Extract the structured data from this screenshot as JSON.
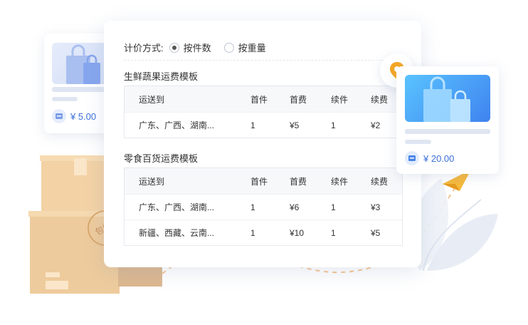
{
  "pricing": {
    "label": "计价方式:",
    "options": [
      {
        "label": "按件数",
        "selected": true
      },
      {
        "label": "按重量",
        "selected": false
      }
    ]
  },
  "columns": [
    "运送到",
    "首件",
    "首费",
    "续件",
    "续费"
  ],
  "templates": [
    {
      "title": "生鲜蔬果运费模板",
      "rows": [
        [
          "广东、广西、湖南...",
          "1",
          "¥5",
          "1",
          "¥2"
        ]
      ]
    },
    {
      "title": "零食百货运费模板",
      "rows": [
        [
          "广东、广西、湖南...",
          "1",
          "¥6",
          "1",
          "¥3"
        ],
        [
          "新疆、西藏、云南...",
          "1",
          "¥10",
          "1",
          "¥5"
        ]
      ]
    }
  ],
  "cards": {
    "left_price": "¥ 5.00",
    "right_price": "¥ 20.00"
  },
  "box_stamp": "包邮",
  "colors": {
    "accent": "#3a6fd8",
    "pin": "#f5a623",
    "paper_plane": "#f6b93b",
    "box": "#eecb9c"
  }
}
